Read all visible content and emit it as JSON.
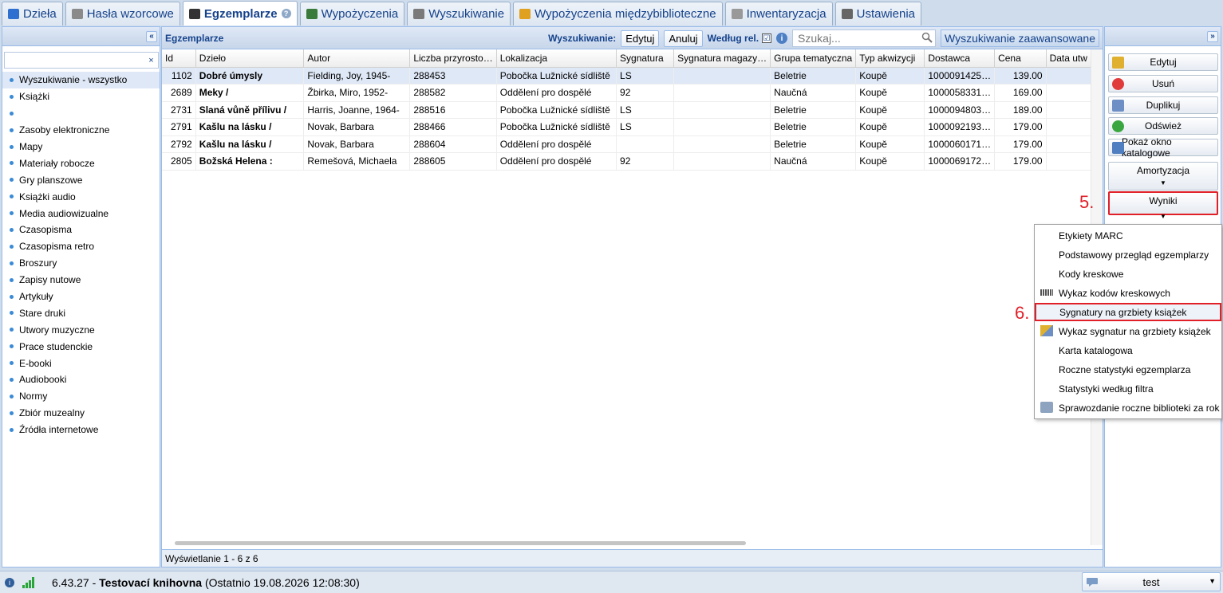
{
  "tabs": [
    {
      "label": "Dzieła",
      "icon": "book-blue-icon",
      "active": false
    },
    {
      "label": "Hasła wzorcowe",
      "icon": "authority-card-icon",
      "active": false
    },
    {
      "label": "Egzemplarze",
      "icon": "pen-icon",
      "active": true
    },
    {
      "label": "Wypożyczenia",
      "icon": "books-stack-icon",
      "active": false
    },
    {
      "label": "Wyszukiwanie",
      "icon": "search-screen-icon",
      "active": false
    },
    {
      "label": "Wypożyczenia międzybiblioteczne",
      "icon": "package-icon",
      "active": false
    },
    {
      "label": "Inwentaryzacja",
      "icon": "document-list-icon",
      "active": false
    },
    {
      "label": "Ustawienia",
      "icon": "tools-icon",
      "active": false
    }
  ],
  "left_panel": {
    "search_value": "",
    "clear_symbol": "×",
    "collapse_symbol": "«",
    "categories": [
      "Wyszukiwanie - wszystko",
      "Książki",
      "",
      "Zasoby elektroniczne",
      "Mapy",
      "Materiały robocze",
      "Gry planszowe",
      "Książki audio",
      "Media audiowizualne",
      "Czasopisma",
      "Czasopisma retro",
      "Broszury",
      "Zapisy nutowe",
      "Artykuły",
      "Stare druki",
      "Utwory muzyczne",
      "Prace studenckie",
      "E-booki",
      "Audiobooki",
      "Normy",
      "Zbiór muzealny",
      "Źródła internetowe"
    ],
    "selected_index": 0
  },
  "center": {
    "title": "Egzemplarze",
    "toolbar": {
      "search_label": "Wyszukiwanie:",
      "edit_label": "Edytuj",
      "cancel_label": "Anuluj",
      "relevance_label": "Według rel.",
      "relevance_checked": "☑",
      "info_symbol": "i",
      "search_placeholder": "Szukaj...",
      "advanced_label": "Wyszukiwanie zaawansowane"
    },
    "columns": [
      "Id",
      "Dzieło",
      "Autor",
      "Liczba przyrosto…",
      "Lokalizacja",
      "Sygnatura",
      "Sygnatura magazy…",
      "Grupa tematyczna",
      "Typ akwizycji",
      "Dostawca",
      "Cena",
      "Data utw"
    ],
    "rows": [
      [
        "1102",
        "Dobré úmysly",
        "Fielding, Joy, 1945-",
        "288453",
        "Pobočka Lužnické sídliště",
        "LS",
        "",
        "Beletrie",
        "Koupě",
        "1000091425…",
        "139.00",
        ""
      ],
      [
        "2689",
        "Meky /",
        "Žbirka, Miro, 1952-",
        "288582",
        "Oddělení pro dospělé",
        "92",
        "",
        "Naučná",
        "Koupě",
        "1000058331…",
        "169.00",
        ""
      ],
      [
        "2731",
        "Slaná vůně přílivu /",
        "Harris, Joanne, 1964-",
        "288516",
        "Pobočka Lužnické sídliště",
        "LS",
        "",
        "Beletrie",
        "Koupě",
        "1000094803…",
        "189.00",
        ""
      ],
      [
        "2791",
        "Kašlu na lásku /",
        "Novak, Barbara",
        "288466",
        "Pobočka Lužnické sídliště",
        "LS",
        "",
        "Beletrie",
        "Koupě",
        "1000092193…",
        "179.00",
        ""
      ],
      [
        "2792",
        "Kašlu na lásku /",
        "Novak, Barbara",
        "288604",
        "Oddělení pro dospělé",
        "",
        "",
        "Beletrie",
        "Koupě",
        "1000060171…",
        "179.00",
        ""
      ],
      [
        "2805",
        "Božská Helena :",
        "Remešová, Michaela",
        "288605",
        "Oddělení pro dospělé",
        "92",
        "",
        "Naučná",
        "Koupě",
        "1000069172…",
        "179.00",
        ""
      ]
    ],
    "selected_row": 0,
    "footer": "Wyświetlanie 1 - 6 z 6"
  },
  "right_panel": {
    "collapse_symbol": "»",
    "buttons": [
      {
        "label": "Edytuj",
        "icon": "edit-icon"
      },
      {
        "label": "Usuń",
        "icon": "delete-icon"
      },
      {
        "label": "Duplikuj",
        "icon": "duplicate-icon"
      },
      {
        "label": "Odśwież",
        "icon": "refresh-icon"
      },
      {
        "label": "Pokaż okno katalogowe",
        "icon": "catalog-window-icon"
      }
    ],
    "amortization_label": "Amortyzacja",
    "results_label": "Wyniki",
    "dropdown_arrow": "▼"
  },
  "annotations": {
    "step5": "5.",
    "step6": "6."
  },
  "results_menu": [
    {
      "label": "Etykiety MARC",
      "icon": ""
    },
    {
      "label": "Podstawowy przegląd egzemplarzy",
      "icon": ""
    },
    {
      "label": "Kody kreskowe",
      "icon": ""
    },
    {
      "label": "Wykaz kodów kreskowych",
      "icon": "barcode-icon"
    },
    {
      "label": "Sygnatury na grzbiety książek",
      "icon": ""
    },
    {
      "label": "Wykaz sygnatur na grzbiety książek",
      "icon": "pencil-label-icon"
    },
    {
      "label": "Karta katalogowa",
      "icon": ""
    },
    {
      "label": "Roczne statystyki egzemplarza",
      "icon": ""
    },
    {
      "label": "Statystyki według filtra",
      "icon": ""
    },
    {
      "label": "Sprawozdanie roczne biblioteki za rok",
      "icon": "printer-icon"
    }
  ],
  "status_bar": {
    "info_symbol": "i",
    "version": "6.43.27 - ",
    "library": "Testovací knihovna",
    "last_login": " (Ostatnio 19.08.2026 12:08:30)",
    "user": "test"
  },
  "colors": {
    "highlight": "#e01f28",
    "header_text": "#15428b",
    "selection": "#dfe8f6"
  }
}
